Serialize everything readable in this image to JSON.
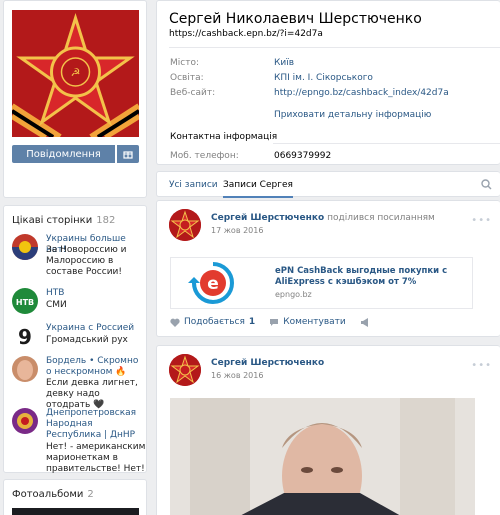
{
  "profile": {
    "name": "Сергей Николаевич Шерстюченко",
    "link": "https://cashback.epn.bz/?i=42d7a",
    "fields": [
      {
        "label": "Місто:",
        "value": "Київ"
      },
      {
        "label": "Освіта:",
        "value": "КПІ ім. І. Сікорського"
      },
      {
        "label": "Веб-сайт:",
        "value": "http://epngo.bz/cashback_index/42d7a"
      }
    ],
    "hide_details": "Приховати детальну інформацію",
    "contact_title": "Контактна інформація",
    "phone_label": "Моб. телефон:",
    "phone_value": "0669379992"
  },
  "left": {
    "message_button": "Повідомлення",
    "gift_icon": "gift-icon"
  },
  "pages": {
    "title": "Цікаві сторінки",
    "count": "182",
    "items": [
      {
        "name": "Украины больше нет!",
        "desc": "За Новороссию и Малороссию в составе России!"
      },
      {
        "name": "НТВ",
        "desc": "СМИ"
      },
      {
        "name": "Украина с Россией",
        "desc": "Громадський рух"
      },
      {
        "name": "Бордель • Скромно о нескромном 🔥",
        "desc": "Если девка лигнет, девку надо отодрать 🖤"
      },
      {
        "name": "Днепропетровская Народная Республика | ДнНР",
        "desc": "Нет! - американским марионеткам в правительстве! Нет! -"
      }
    ]
  },
  "photos": {
    "title": "Фотоальбоми",
    "count": "2"
  },
  "tabs": {
    "all": "Усі записи",
    "own": "Записи Сергея"
  },
  "posts": [
    {
      "author": "Сергей Шерстюченко",
      "action": "поділився посиланням",
      "date": "17 жов 2016",
      "snippet_title": "ePN CashBack выгодные покупки с AliExpress с кэшбэком от 7%",
      "snippet_domain": "epngo.bz",
      "like_label": "Подобається",
      "like_count": "1",
      "comment_label": "Коментувати"
    },
    {
      "author": "Сергей Шерстюченко",
      "date": "16 жов 2016"
    }
  ]
}
